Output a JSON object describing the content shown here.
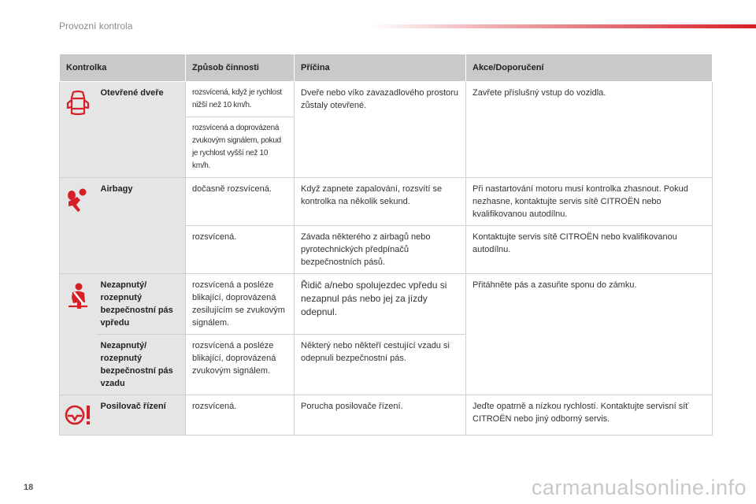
{
  "header": {
    "title": "Provozní kontrola"
  },
  "page_number": "18",
  "watermark": "carmanualsonline.info",
  "table": {
    "columns": [
      "Kontrolka",
      "Způsob činnosti",
      "Příčina",
      "Akce/Doporučení"
    ],
    "doors": {
      "name": "Otevřené dveře",
      "mode_1": "rozsvícená, když je rychlost nižší než 10 km/h.",
      "mode_2": "rozsvícená a doprovázená zvukovým signálem, pokud je rychlost vyšší než 10 km/h.",
      "cause": "Dveře nebo víko zavazadlového prostoru zůstaly otevřené.",
      "action": "Zavřete příslušný vstup do vozidla."
    },
    "airbags": {
      "name": "Airbagy",
      "mode_1": "dočasně rozsvícená.",
      "cause_1": "Když zapnete zapalování, rozsvítí se kontrolka na několik sekund.",
      "action_1": "Při nastartování motoru musí kontrolka zhasnout. Pokud nezhasne, kontaktujte servis sítě CITROËN nebo kvalifikovanou autodílnu.",
      "mode_2": "rozsvícená.",
      "cause_2": "Závada některého z airbagů nebo pyrotechnických předpínačů bezpečnostních pásů.",
      "action_2": "Kontaktujte servis sítě CITROËN nebo kvalifikovanou autodílnu."
    },
    "seatbelt_front": {
      "name": "Nezapnutý/ rozepnutý bezpečnostní pás vpředu",
      "mode": "rozsvícená a posléze blikající, doprovázená zesilujícím se zvukovým signálem.",
      "cause": "Řidič a/nebo spolujezdec vpředu si nezapnul pás nebo jej za jízdy odepnul.",
      "action": "Přitáhněte pás a zasuňte sponu do zámku."
    },
    "seatbelt_rear": {
      "name": "Nezapnutý/ rozepnutý bezpečnostní pás vzadu",
      "mode": "rozsvícená a posléze blikající, doprovázená zvukovým signálem.",
      "cause": "Některý nebo někteří cestující vzadu si odepnuli bezpečnostní pás."
    },
    "steering": {
      "name": "Posilovač řízení",
      "mode": "rozsvícená.",
      "cause": "Porucha posilovače řízení.",
      "action": "Jeďte opatrně a nízkou rychlostí. Kontaktujte servisní síť CITROËN nebo jiný odborný servis."
    }
  },
  "icons": {
    "doors": "car-doors-open-icon",
    "airbags": "airbag-icon",
    "seatbelt": "seatbelt-icon",
    "steering": "power-steering-icon",
    "color": "#d62028"
  }
}
